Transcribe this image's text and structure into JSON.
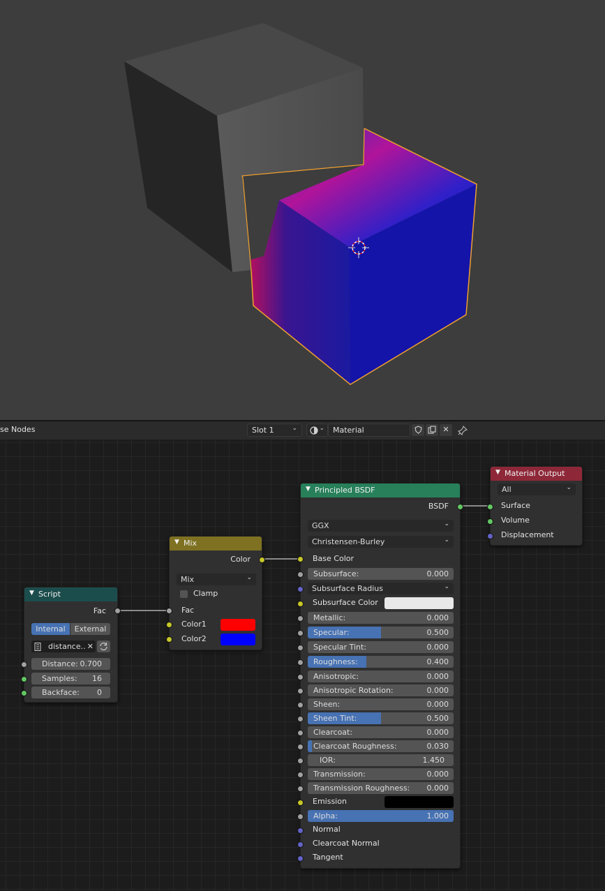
{
  "header": {
    "editor_title": "se Nodes",
    "slot_label": "Slot 1",
    "material_name": "Material"
  },
  "nodes": {
    "script": {
      "title": "Script",
      "output_fac": "Fac",
      "mode_internal": "Internal",
      "mode_external": "External",
      "file_name": "distance..",
      "inputs": [
        {
          "label": "Distance:",
          "value": "0.700"
        },
        {
          "label": "Samples:",
          "value": "16"
        },
        {
          "label": "Backface:",
          "value": "0"
        }
      ]
    },
    "mix": {
      "title": "Mix",
      "output_color": "Color",
      "blend_mode": "Mix",
      "clamp_label": "Clamp",
      "clamp_checked": false,
      "fac_label": "Fac",
      "color1_label": "Color1",
      "color2_label": "Color2",
      "color1": "#ff0000",
      "color2": "#0000ff"
    },
    "principled": {
      "title": "Principled BSDF",
      "output_bsdf": "BSDF",
      "distribution": "GGX",
      "subsurface_method": "Christensen-Burley",
      "base_color_label": "Base Color",
      "subsurface": {
        "label": "Subsurface:",
        "value": "0.000",
        "fill": 0
      },
      "subsurface_radius_label": "Subsurface Radius",
      "subsurface_color_label": "Subsurface Color",
      "subsurface_color": "#e8e8e8",
      "metallic": {
        "label": "Metallic:",
        "value": "0.000",
        "fill": 0
      },
      "specular": {
        "label": "Specular:",
        "value": "0.500",
        "fill": 0.5
      },
      "specular_tint": {
        "label": "Specular Tint:",
        "value": "0.000",
        "fill": 0
      },
      "roughness": {
        "label": "Roughness:",
        "value": "0.400",
        "fill": 0.4
      },
      "anisotropic": {
        "label": "Anisotropic:",
        "value": "0.000",
        "fill": 0
      },
      "anisotropic_rotation": {
        "label": "Anisotropic Rotation:",
        "value": "0.000",
        "fill": 0
      },
      "sheen": {
        "label": "Sheen:",
        "value": "0.000",
        "fill": 0
      },
      "sheen_tint": {
        "label": "Sheen Tint:",
        "value": "0.500",
        "fill": 0.5
      },
      "clearcoat": {
        "label": "Clearcoat:",
        "value": "0.000",
        "fill": 0
      },
      "clearcoat_roughness": {
        "label": "Clearcoat Roughness:",
        "value": "0.030",
        "fill": 0.03
      },
      "ior": {
        "label": "IOR:",
        "value": "1.450"
      },
      "transmission": {
        "label": "Transmission:",
        "value": "0.000",
        "fill": 0
      },
      "transmission_roughness": {
        "label": "Transmission Roughness:",
        "value": "0.000",
        "fill": 0
      },
      "emission_label": "Emission",
      "emission_color": "#000000",
      "alpha": {
        "label": "Alpha:",
        "value": "1.000",
        "fill": 1
      },
      "normal_label": "Normal",
      "clearcoat_normal_label": "Clearcoat Normal",
      "tangent_label": "Tangent"
    },
    "output": {
      "title": "Material Output",
      "target": "All",
      "surface_label": "Surface",
      "volume_label": "Volume",
      "displacement_label": "Displacement"
    }
  },
  "colors": {
    "script_header": "#1c4d4d",
    "mix_header": "#7e7121",
    "principled_header": "#27805a",
    "output_header": "#8e2838",
    "selection_outline": "#f0a030",
    "field_fill": "#4772b3"
  },
  "icons": {
    "header_material_icon": "material-sphere-icon",
    "shield_icon": "shield-icon",
    "duplicate_icon": "duplicate-icon",
    "unlink_icon": "close-icon",
    "pin_icon": "pin-icon",
    "script_file_icon": "text-file-icon",
    "script_reload_icon": "reload-icon"
  }
}
